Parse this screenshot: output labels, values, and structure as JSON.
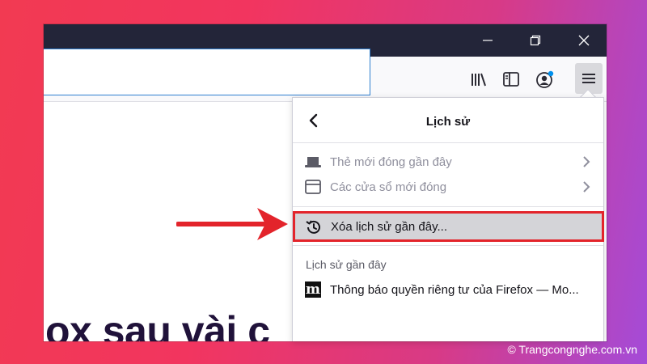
{
  "colors": {
    "titlebar": "#232539",
    "highlight_border": "#e3242b",
    "arrow": "#e3242b",
    "notification_dot": "#0090ed"
  },
  "window_controls": {
    "minimize_icon": "minimize-icon",
    "restore_icon": "restore-icon",
    "close_icon": "close-icon"
  },
  "toolbar": {
    "icons": [
      "library-icon",
      "sidebar-icon",
      "account-icon",
      "hamburger-menu-icon"
    ]
  },
  "page": {
    "partial_heading": "ox sau vài c"
  },
  "panel": {
    "title": "Lịch sử",
    "items": [
      {
        "label": "Thẻ mới đóng gần đây",
        "icon": "tab-icon",
        "enabled": false
      },
      {
        "label": "Các cửa sổ mới đóng",
        "icon": "window-icon",
        "enabled": false
      }
    ],
    "clear_history_label": "Xóa lịch sử gần đây...",
    "recent_section_title": "Lịch sử gần đây",
    "recent_items": [
      {
        "label": "Thông báo quyền riêng tư của Firefox — Mo...",
        "favicon_letter": "m"
      }
    ]
  },
  "watermark": "© Trangcongnghe.com.vn"
}
